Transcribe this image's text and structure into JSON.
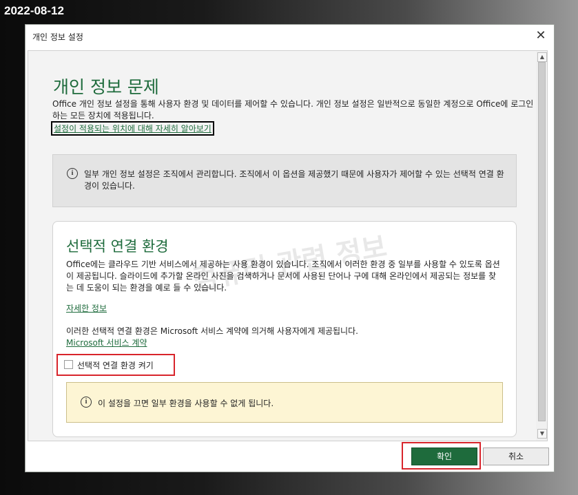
{
  "date_stamp": "2022-08-12",
  "dialog": {
    "title": "개인 정보 설정",
    "close_glyph": "✕"
  },
  "privacy": {
    "heading": "개인 정보 문제",
    "description": "Office 개인 정보 설정을 통해 사용자 환경 및 데이터를 제어할 수 있습니다. 개인 정보 설정은 일반적으로 동일한 계정으로 Office에 로그인하는 모든 장치에 적용됩니다.",
    "learn_link": "설정이 적용되는 위치에 대해 자세히 알아보기"
  },
  "managed_notice": {
    "icon": "info-icon",
    "icon_glyph": "i",
    "text": "일부 개인 정보 설정은 조직에서 관리합니다. 조직에서 이 옵션을 제공했기 때문에 사용자가 제어할 수 있는 선택적 연결 환경이 있습니다."
  },
  "watermark": "컴퓨터 관련 정보",
  "optional": {
    "heading": "선택적 연결 환경",
    "description": "Office에는 클라우드 기반 서비스에서 제공하는 사용 환경이 있습니다. 조직에서 이러한 환경 중 일부를 사용할 수 있도록 옵션이 제공됩니다. 슬라이드에 추가할 온라인 사진을 검색하거나 문서에 사용된 단어나 구에 대해 온라인에서 제공되는 정보를 찾는 데 도움이 되는 환경을 예로 들 수 있습니다.",
    "more_link": "자세한 정보",
    "agreement_text": "이러한 선택적 연결 환경은 Microsoft 서비스 계약에 의거해 사용자에게 제공됩니다.",
    "service_link": "Microsoft 서비스 계약",
    "checkbox_label": "선택적 연결 환경 켜기",
    "checkbox_checked": false,
    "warning": "이 설정을 끄면 일부 환경을 사용할 수 없게 됩니다."
  },
  "buttons": {
    "ok": "확인",
    "cancel": "취소"
  },
  "scrollbar": {
    "up_glyph": "▲",
    "down_glyph": "▼"
  },
  "colors": {
    "accent_green": "#1e6b3c",
    "highlight_red": "#d8232a",
    "warning_bg": "#fdf5d4"
  }
}
